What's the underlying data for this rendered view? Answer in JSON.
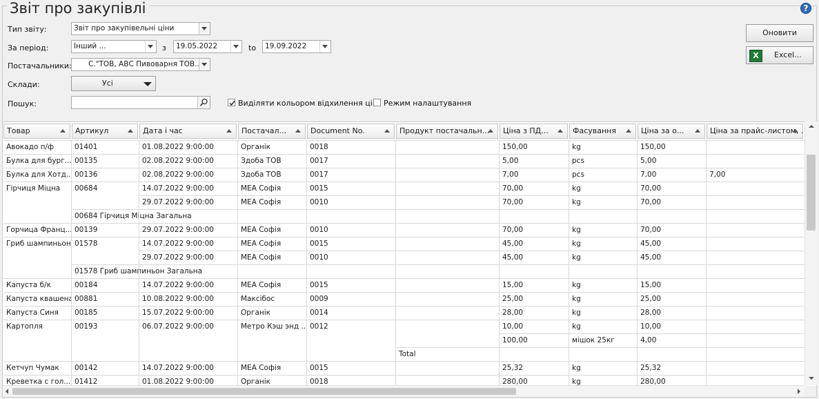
{
  "title": "Звіт про закупівлі",
  "help_icon": "?",
  "filters": {
    "report_type_label": "Тип звіту:",
    "report_type_value": "Звіт про закупівельні ціни",
    "period_label": "За період:",
    "period_value": "Інший ...",
    "from_label": "з",
    "date_from": "19.05.2022",
    "to_label": "to",
    "date_to": "19.09.2022",
    "suppliers_label": "Постачальники:",
    "suppliers_value": "С.\"ТОВ, АВС Пивоварня ТОВ...",
    "warehouses_label": "Склади:",
    "warehouses_value": "Усі",
    "search_label": "Пошук:",
    "search_value": "",
    "highlight_label": "Виділяти кольором відхилення цін",
    "highlight_checked": true,
    "setup_label": "Режим налаштування",
    "setup_checked": false
  },
  "buttons": {
    "refresh": "Оновити",
    "excel": "Excel..."
  },
  "columns": [
    "Товар",
    "Артикул",
    "Дата і час",
    "Постачал...",
    "Document No.",
    "Продукт постачальн...",
    "Ціна з ПД...",
    "Фасування",
    "Ціна за о...",
    "Ціна за прайс-листом, ..."
  ],
  "rows": [
    [
      "Авокадо п/ф",
      "01401",
      "01.08.2022 9:00:00",
      "Органік",
      "0018",
      "",
      "150,00",
      "kg",
      "150,00",
      ""
    ],
    [
      "Булка для бург...",
      "00135",
      "02.08.2022 9:00:00",
      "Здоба ТОВ",
      "0017",
      "",
      "5,00",
      "pcs",
      "5,00",
      ""
    ],
    [
      "Булка для Хотд...",
      "00136",
      "02.08.2022 9:00:00",
      "Здоба ТОВ",
      "0017",
      "",
      "7,00",
      "pcs",
      "7,00",
      "7,00"
    ],
    [
      "Гірчиця Міцна",
      "00684",
      "14.07.2022 9:00:00",
      "МЕА Софія",
      "0015",
      "",
      "70,00",
      "kg",
      "70,00",
      ""
    ],
    [
      "",
      "",
      "29.07.2022 9:00:00",
      "МЕА Софія",
      "0010",
      "",
      "70,00",
      "kg",
      "70,00",
      ""
    ],
    [
      "",
      "00684 Гірчиця Міцна Загальна",
      "",
      "",
      "",
      "",
      "",
      "",
      "",
      ""
    ],
    [
      "Горчица Франц...",
      "00139",
      "29.07.2022 9:00:00",
      "МЕА Софія",
      "0010",
      "",
      "70,00",
      "kg",
      "70,00",
      ""
    ],
    [
      "Гриб шампиньон",
      "01578",
      "14.07.2022 9:00:00",
      "МЕА Софія",
      "0015",
      "",
      "45,00",
      "kg",
      "45,00",
      ""
    ],
    [
      "",
      "",
      "29.07.2022 9:00:00",
      "МЕА Софія",
      "0010",
      "",
      "45,00",
      "kg",
      "45,00",
      ""
    ],
    [
      "",
      "01578 Гриб шампиньон Загальна",
      "",
      "",
      "",
      "",
      "",
      "",
      "",
      ""
    ],
    [
      "Капуста б/к",
      "00184",
      "14.07.2022 9:00:00",
      "МЕА Софія",
      "0015",
      "",
      "15,00",
      "kg",
      "15,00",
      ""
    ],
    [
      "Капуста квашена",
      "00881",
      "10.08.2022 9:00:00",
      "Максібос",
      "0009",
      "",
      "25,00",
      "kg",
      "25,00",
      ""
    ],
    [
      "Капуста Синя",
      "00185",
      "15.07.2022 9:00:00",
      "Органік",
      "0014",
      "",
      "28,00",
      "kg",
      "28,00",
      ""
    ],
    [
      "Картопля",
      "00193",
      "06.07.2022 9:00:00",
      "Метро Кэш энд ...",
      "0012",
      "",
      "10,00",
      "kg",
      "10,00",
      ""
    ],
    [
      "",
      "",
      "",
      "",
      "",
      "",
      "100,00",
      "мішок 25кг",
      "4,00",
      ""
    ],
    [
      "",
      "",
      "",
      "",
      "",
      "Total",
      "",
      "",
      "",
      ""
    ],
    [
      "Кетчуп Чумак",
      "00142",
      "14.07.2022 9:00:00",
      "МЕА Софія",
      "0015",
      "",
      "25,32",
      "kg",
      "25,32",
      ""
    ],
    [
      "Креветка с гол...",
      "01412",
      "01.08.2022 9:00:00",
      "Органік",
      "0018",
      "",
      "280,00",
      "kg",
      "280,00",
      ""
    ]
  ]
}
